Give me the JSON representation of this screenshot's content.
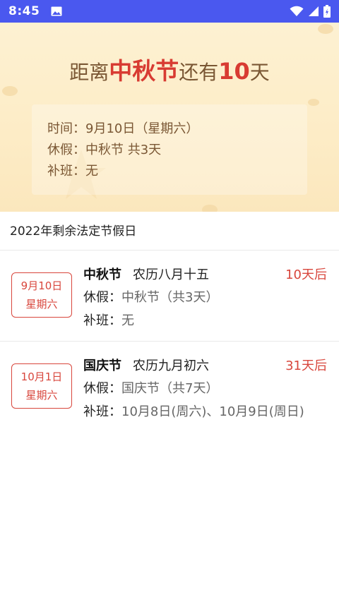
{
  "status_bar": {
    "time": "8:45"
  },
  "hero": {
    "prefix": "距离",
    "festival": "中秋节",
    "middle": "还有",
    "days": "10",
    "suffix": "天",
    "info": [
      "时间：9月10日（星期六）",
      "休假：中秋节 共3天",
      "补班：无"
    ]
  },
  "section_title": "2022年剩余法定节假日",
  "holidays": [
    {
      "date": "9月10日",
      "weekday": "星期六",
      "name": "中秋节",
      "lunar": "农历八月十五",
      "countdown": "10天后",
      "vacation_label": "休假：",
      "vacation": "中秋节（共3天）",
      "makeup_label": "补班：",
      "makeup": "无"
    },
    {
      "date": "10月1日",
      "weekday": "星期六",
      "name": "国庆节",
      "lunar": "农历九月初六",
      "countdown": "31天后",
      "vacation_label": "休假：",
      "vacation": "国庆节（共7天）",
      "makeup_label": "补班：",
      "makeup": "10月8日(周六)、10月9日(周日)"
    }
  ],
  "colors": {
    "accent": "#d83b32",
    "status_bar": "#4a58ef",
    "hero_bg": "#fdecc6",
    "hero_text": "#7a5734"
  },
  "icons": [
    "image-icon",
    "wifi-icon",
    "signal-icon",
    "battery-icon"
  ]
}
